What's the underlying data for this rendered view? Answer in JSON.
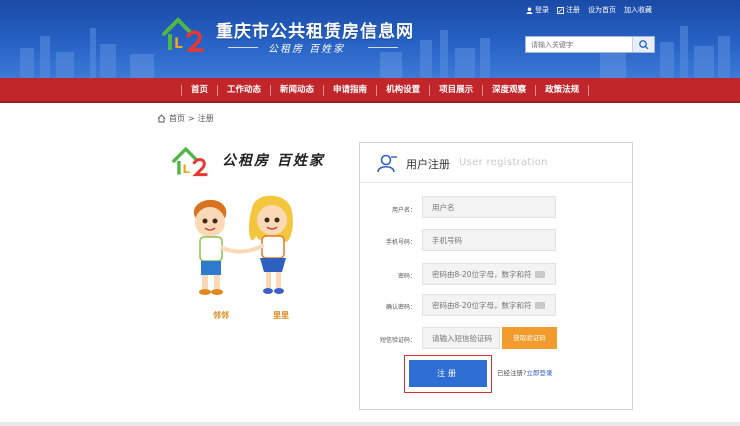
{
  "header": {
    "title": "重庆市公共租赁房信息网",
    "slogan": "公租房 百姓家",
    "top_links": [
      "登录",
      "注册",
      "设为首页",
      "加入收藏"
    ],
    "search_placeholder": "请输入关键字"
  },
  "nav": {
    "items": [
      "首页",
      "工作动态",
      "新闻动态",
      "申请指南",
      "机构设置",
      "项目展示",
      "深度观察",
      "政策法规"
    ]
  },
  "breadcrumb": {
    "home": "首页",
    "separator": ">",
    "current": "注册"
  },
  "promo": {
    "slogan": "公租房  百姓家",
    "mascot_left": "邻邻",
    "mascot_right": "里里"
  },
  "form": {
    "title": "用户注册",
    "title_en": "User registration",
    "fields": [
      {
        "label": "用户名：",
        "placeholder": "用户名"
      },
      {
        "label": "手机号码：",
        "placeholder": "手机号码"
      },
      {
        "label": "密码：",
        "placeholder": "密码由8-20位字母，数字和符"
      },
      {
        "label": "确认密码：",
        "placeholder": "密码由8-20位字母，数字和符"
      },
      {
        "label": "短信验证码：",
        "placeholder": "请输入短信验证码"
      }
    ],
    "sms_button": "获取验证码",
    "submit": "注册",
    "login_hint": "已经注册?",
    "login_link": "立即登录"
  },
  "colors": {
    "header_blue": "#2762c4",
    "nav_red": "#c0262a",
    "accent_orange": "#f39b2d",
    "button_blue": "#2f6ed3",
    "highlight_red": "#d7332f"
  }
}
